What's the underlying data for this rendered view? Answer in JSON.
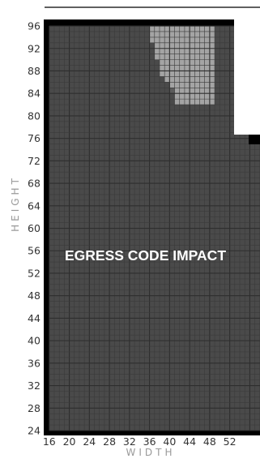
{
  "chart_data": {
    "type": "heatmap",
    "title": "",
    "xlabel": "WIDTH",
    "ylabel": "HEIGHT",
    "annotation": "EGRESS CODE IMPACT",
    "xlim": [
      16,
      53
    ],
    "ylim": [
      24,
      96
    ],
    "x_ticks": [
      16,
      20,
      24,
      28,
      32,
      36,
      40,
      44,
      48,
      52
    ],
    "y_ticks": [
      24,
      28,
      32,
      36,
      40,
      44,
      48,
      52,
      56,
      60,
      64,
      68,
      72,
      76,
      80,
      84,
      88,
      92,
      96
    ],
    "x_tick_labels": [
      "16",
      "20",
      "24",
      "28",
      "32",
      "36",
      "40",
      "44",
      "48",
      "52"
    ],
    "y_tick_labels": [
      "24",
      "28",
      "32",
      "36",
      "40",
      "44",
      "48",
      "52",
      "56",
      "60",
      "64",
      "68",
      "72",
      "76",
      "80",
      "84",
      "88",
      "92",
      "96"
    ],
    "grid": true,
    "cell_size": 1,
    "legend": "none",
    "regions": [
      {
        "value": "impacted",
        "color": "#4a4a4a",
        "description_range": {
          "x": [
            16,
            53
          ],
          "y": [
            24,
            96
          ]
        }
      },
      {
        "value": "compliant",
        "color": "#a4a4a4",
        "boundary": [
          {
            "y_min": 93,
            "y_max": 96,
            "x_min": 36
          },
          {
            "y_min": 90,
            "y_max": 93,
            "x_min": 37
          },
          {
            "y_min": 87,
            "y_max": 90,
            "x_min": 38
          },
          {
            "y_min": 86,
            "y_max": 87,
            "x_min": 39
          },
          {
            "y_min": 85,
            "y_max": 86,
            "x_min": 40
          },
          {
            "y_min": 84,
            "y_max": 85,
            "x_min": 41
          },
          {
            "y_min": 82,
            "y_max": 84,
            "x_min": 41
          }
        ],
        "x_max": 49
      }
    ],
    "colors": {
      "impacted": "#4a4a4a",
      "compliant": "#a4a4a4",
      "gridline": "#3a3a3a",
      "frame": "#000000",
      "annotation": "#ffffff"
    }
  }
}
